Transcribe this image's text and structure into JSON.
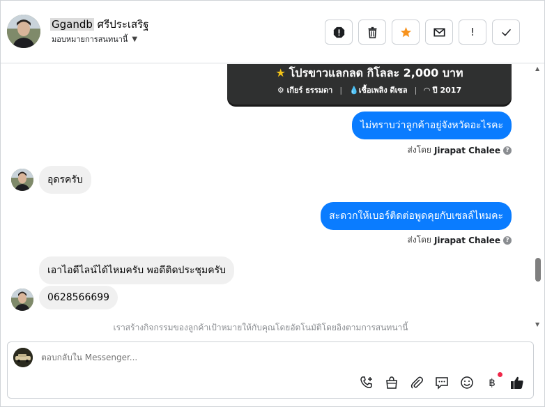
{
  "header": {
    "name_highlight": "Ggandb",
    "name_rest": "ศรีประเสริฐ",
    "assign_label": "มอบหมายการสนทนานี้",
    "actions": [
      {
        "name": "spam-button",
        "icon": "alert-octagon-icon",
        "glyph": "!"
      },
      {
        "name": "delete-button",
        "icon": "trash-icon",
        "glyph": ""
      },
      {
        "name": "star-button",
        "icon": "star-icon",
        "glyph": "★"
      },
      {
        "name": "email-button",
        "icon": "envelope-icon",
        "glyph": "✉"
      },
      {
        "name": "follow-up-button",
        "icon": "exclamation-icon",
        "glyph": "!"
      },
      {
        "name": "done-button",
        "icon": "check-icon",
        "glyph": "✓"
      }
    ]
  },
  "card": {
    "title": "โปรขาวแลกลด กิโลละ 2,000 บาท",
    "gear": "เกียร์ ธรรมดา",
    "fuel": "เชื้อเพลิง ดีเซล",
    "year": "ปี 2017"
  },
  "messages": {
    "m1": "ไม่ทราบว่าลูกค้าอยู่จังหวัดอะไรคะ",
    "m2": "อุดรครับ",
    "m3": "สะดวกให้เบอร์ติดต่อพูดคุยกับเซลล์ไหมคะ",
    "m4": "เอาไอดีไลน์ได้ไหมครับ พอดีติดประชุมครับ",
    "m5": "0628566699"
  },
  "sent_by": {
    "prefix": "ส่งโดย",
    "agent": "Jirapat Chalee"
  },
  "notice": "เราสร้างกิจกรรมของลูกค้าเป้าหมายให้กับคุณโดยอัตโนมัติโดยอิงตามการสนทนานี้",
  "composer": {
    "placeholder": "ตอบกลับใน Messenger...",
    "currency_glyph": "฿"
  },
  "colors": {
    "outgoing": "#0a7cff",
    "incoming": "#f0f0f0",
    "star": "#f7931e",
    "card": "#2f3030"
  }
}
